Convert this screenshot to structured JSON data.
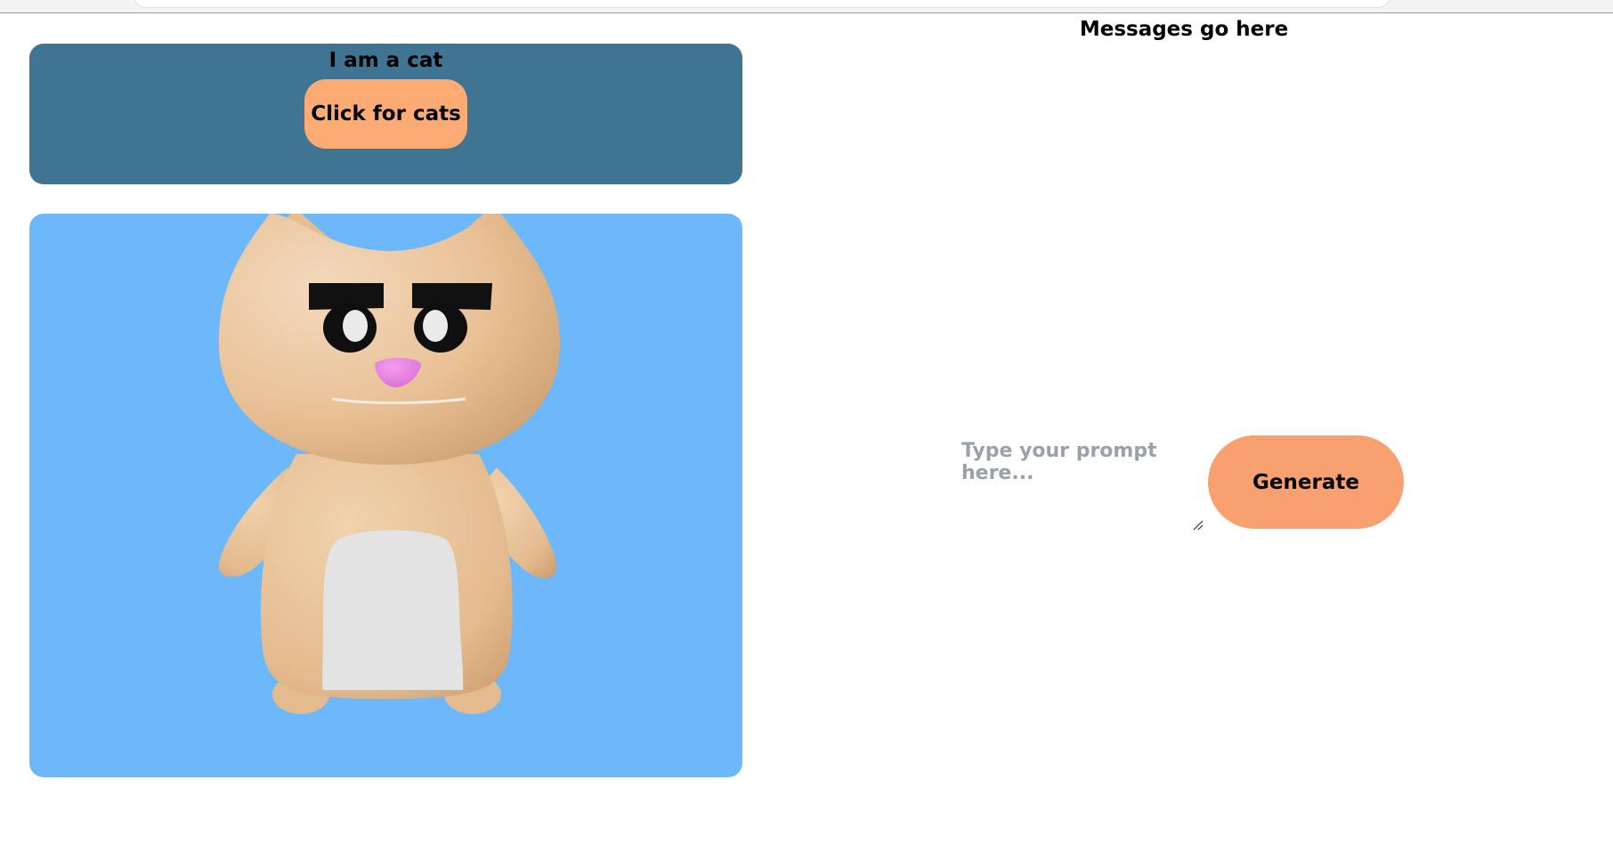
{
  "header": {
    "title": "I am a cat",
    "button_label": "Click for cats"
  },
  "scene": {
    "subject": "cat-3d-model",
    "background_color": "#6db7fb"
  },
  "messages": {
    "heading": "Messages go here"
  },
  "prompt": {
    "placeholder": "Type your prompt here...",
    "value": "",
    "generate_label": "Generate"
  },
  "colors": {
    "header_bg": "#3f7593",
    "button_accent": "#fdab74",
    "generate_accent": "#f9a070",
    "scene_bg": "#6db7fb"
  }
}
